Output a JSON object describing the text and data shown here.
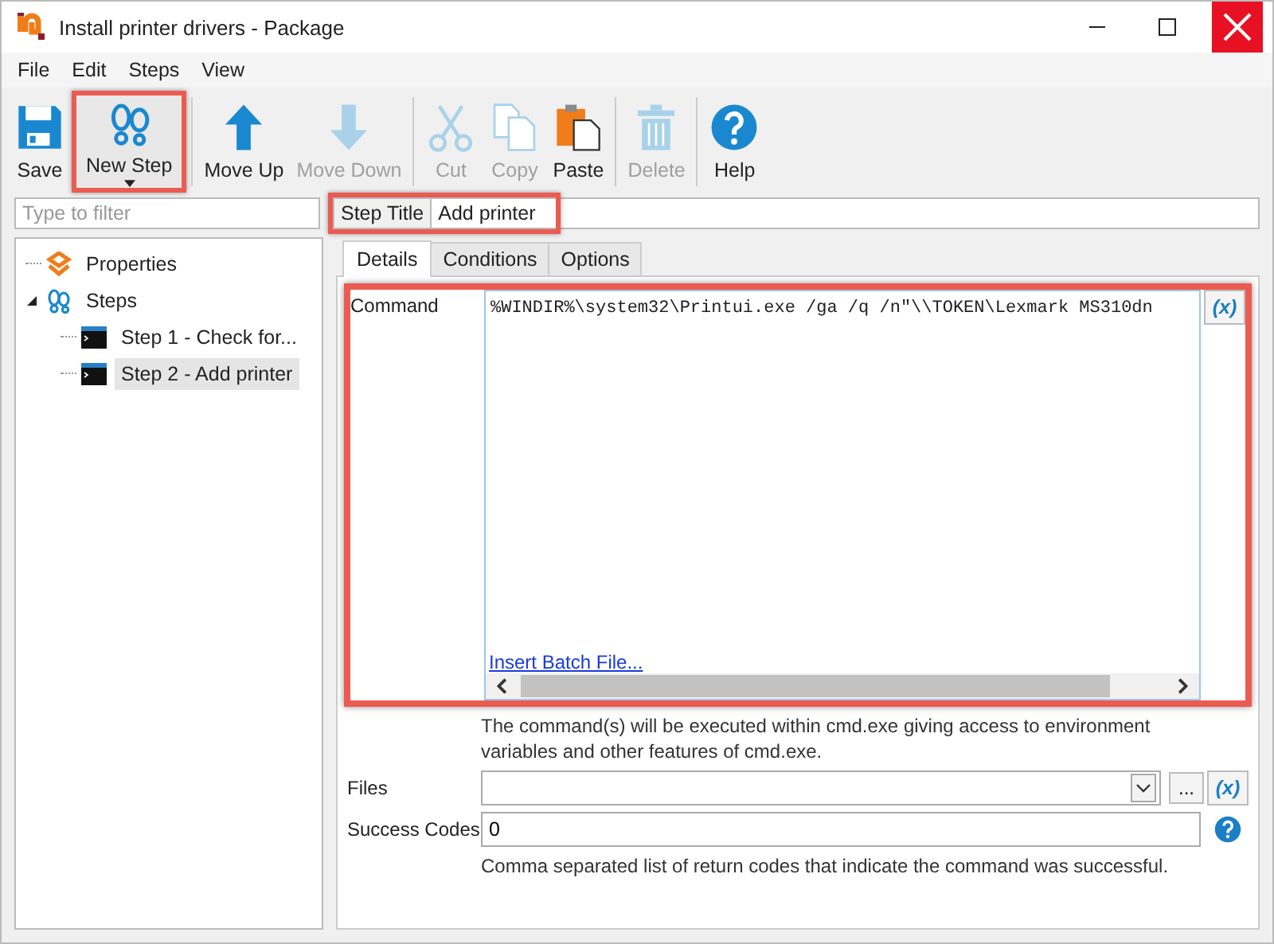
{
  "window": {
    "title": "Install printer drivers - Package"
  },
  "menu": [
    "File",
    "Edit",
    "Steps",
    "View"
  ],
  "toolbar": [
    [
      {
        "kind": "save",
        "label": "Save",
        "disabled": false,
        "highlighted": false,
        "dropdown": false
      },
      {
        "kind": "new-step",
        "label": "New Step",
        "disabled": false,
        "highlighted": true,
        "dropdown": true
      }
    ],
    [
      {
        "kind": "up",
        "label": "Move Up",
        "disabled": false,
        "highlighted": false,
        "dropdown": false
      },
      {
        "kind": "down",
        "label": "Move Down",
        "disabled": true,
        "highlighted": false,
        "dropdown": false
      }
    ],
    [
      {
        "kind": "cut",
        "label": "Cut",
        "disabled": true,
        "highlighted": false,
        "dropdown": false
      },
      {
        "kind": "copy",
        "label": "Copy",
        "disabled": true,
        "highlighted": false,
        "dropdown": false
      },
      {
        "kind": "paste",
        "label": "Paste",
        "disabled": false,
        "highlighted": false,
        "dropdown": false
      }
    ],
    [
      {
        "kind": "delete",
        "label": "Delete",
        "disabled": true,
        "highlighted": false,
        "dropdown": false
      }
    ],
    [
      {
        "kind": "help",
        "label": "Help",
        "disabled": false,
        "highlighted": false,
        "dropdown": false
      }
    ]
  ],
  "filter": {
    "placeholder": "Type to filter"
  },
  "step_title": {
    "label": "Step Title",
    "value": "Add printer",
    "highlighted": true
  },
  "tree": [
    {
      "label": "Properties",
      "kind": "properties",
      "selected": false
    },
    {
      "label": "Steps",
      "kind": "steps",
      "selected": false,
      "expanded": true,
      "children": [
        {
          "label": "Step 1 - Check for...",
          "kind": "step",
          "selected": false
        },
        {
          "label": "Step 2 - Add printer",
          "kind": "step",
          "selected": true
        }
      ]
    }
  ],
  "tabs": [
    {
      "label": "Details",
      "selected": true
    },
    {
      "label": "Conditions",
      "selected": false
    },
    {
      "label": "Options",
      "selected": false
    }
  ],
  "command": {
    "label": "Command",
    "value": "%WINDIR%\\system32\\Printui.exe /ga /q /n\"\\\\TOKEN\\Lexmark MS310dn",
    "link": "Insert Batch File...",
    "variable_button": "(x)",
    "highlighted": true
  },
  "command_hint": "The command(s) will be executed within cmd.exe giving access to environment variables and other features of cmd.exe.",
  "files": {
    "label": "Files",
    "browse_button": "...",
    "variable_button": "(x)"
  },
  "success_codes": {
    "label": "Success Codes",
    "value": "0"
  },
  "success_hint": "Comma separated list of return codes that indicate the command was successful."
}
